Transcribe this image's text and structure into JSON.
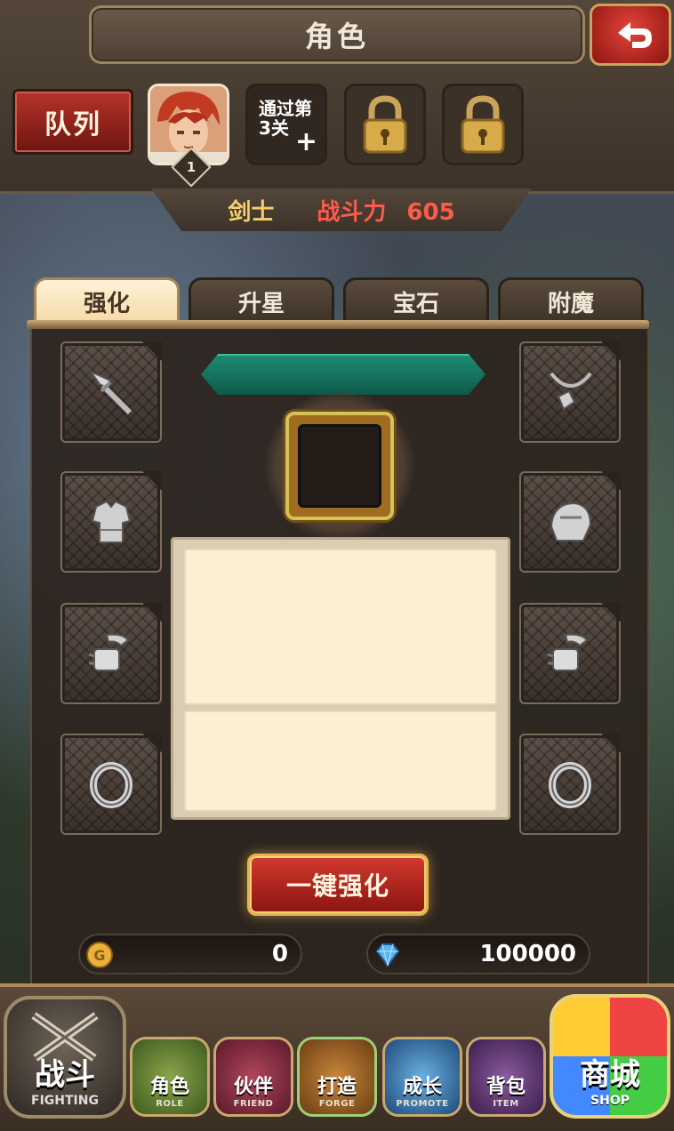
{
  "header": {
    "title": "角色",
    "back_icon": "return-arrow-icon"
  },
  "team": {
    "queue_label": "队列",
    "hero_level": "1",
    "unlock_hint": "通过第3关",
    "unlock_hint_line1": "通过第",
    "unlock_hint_line2": "3关",
    "add_symbol": "+",
    "locked_slots": 2
  },
  "hero_info": {
    "class_name": "剑士",
    "power_label": "战斗力",
    "power_value": "605"
  },
  "tabs": [
    {
      "label": "强化",
      "active": true
    },
    {
      "label": "升星",
      "active": false
    },
    {
      "label": "宝石",
      "active": false
    },
    {
      "label": "附魔",
      "active": false
    }
  ],
  "equipment": {
    "left": [
      "weapon",
      "armor",
      "gloves",
      "ring"
    ],
    "right": [
      "necklace",
      "helmet",
      "gloves",
      "ring"
    ]
  },
  "actions": {
    "enhance_all_label": "一键强化"
  },
  "resources": {
    "gold": "0",
    "diamonds": "100000"
  },
  "nav": [
    {
      "cn": "战斗",
      "en": "FIGHTING"
    },
    {
      "cn": "角色",
      "en": "ROLE"
    },
    {
      "cn": "伙伴",
      "en": "FRIEND"
    },
    {
      "cn": "打造",
      "en": "FORGE"
    },
    {
      "cn": "成长",
      "en": "PROMOTE"
    },
    {
      "cn": "背包",
      "en": "ITEM"
    },
    {
      "cn": "商城",
      "en": "SHOP"
    }
  ],
  "colors": {
    "accent_red": "#b5342a",
    "gold": "#e7b34a",
    "teal": "#1e8a72",
    "power_red": "#ff5a4a"
  }
}
